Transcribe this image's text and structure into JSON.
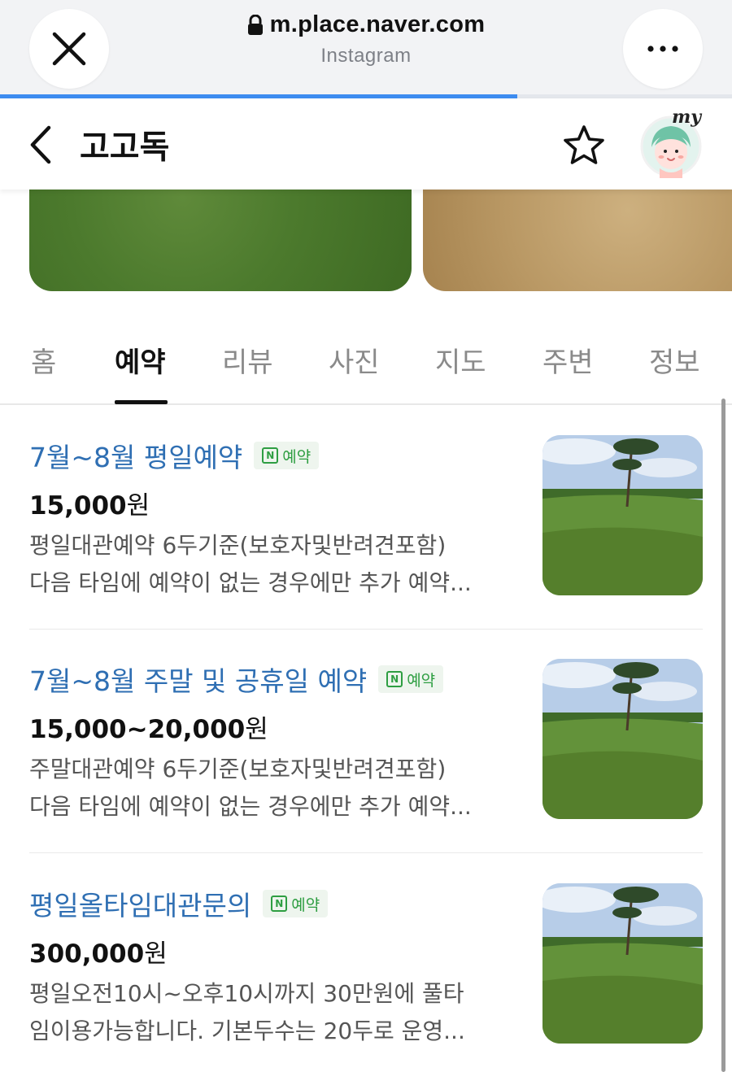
{
  "browser": {
    "url": "m.place.naver.com",
    "source_app": "Instagram",
    "page_load_progress": 0.707
  },
  "header": {
    "title": "고고독",
    "my_label": "my"
  },
  "tabs": [
    {
      "label": "홈",
      "active": false
    },
    {
      "label": "예약",
      "active": true
    },
    {
      "label": "리뷰",
      "active": false
    },
    {
      "label": "사진",
      "active": false
    },
    {
      "label": "지도",
      "active": false
    },
    {
      "label": "주변",
      "active": false
    },
    {
      "label": "정보",
      "active": false
    }
  ],
  "items": [
    {
      "title": "7월~8월 평일예약",
      "badge_letter": "N",
      "badge_label": "예약",
      "price_number": "15,000",
      "price_unit": "원",
      "desc_line1": "평일대관예약 6두기준(보호자및반려견포함)",
      "desc_line2": "다음 타임에 예약이 없는 경우에만 추가 예약..."
    },
    {
      "title": "7월~8월 주말 및 공휴일 예약",
      "badge_letter": "N",
      "badge_label": "예약",
      "price_number": "15,000~20,000",
      "price_unit": "원",
      "desc_line1": "주말대관예약 6두기준(보호자및반려견포함)",
      "desc_line2": "다음 타임에 예약이 없는 경우에만 추가 예약..."
    },
    {
      "title": "평일올타임대관문의",
      "badge_letter": "N",
      "badge_label": "예약",
      "price_number": "300,000",
      "price_unit": "원",
      "desc_line1": "평일오전10시~오후10시까지 30만원에 풀타",
      "desc_line2": "임이용가능합니다. 기본두수는 20두로 운영..."
    }
  ],
  "colors": {
    "title_link": "#2f6fb3",
    "badge_green": "#2e9e42",
    "progress_blue": "#3d8cf0"
  }
}
